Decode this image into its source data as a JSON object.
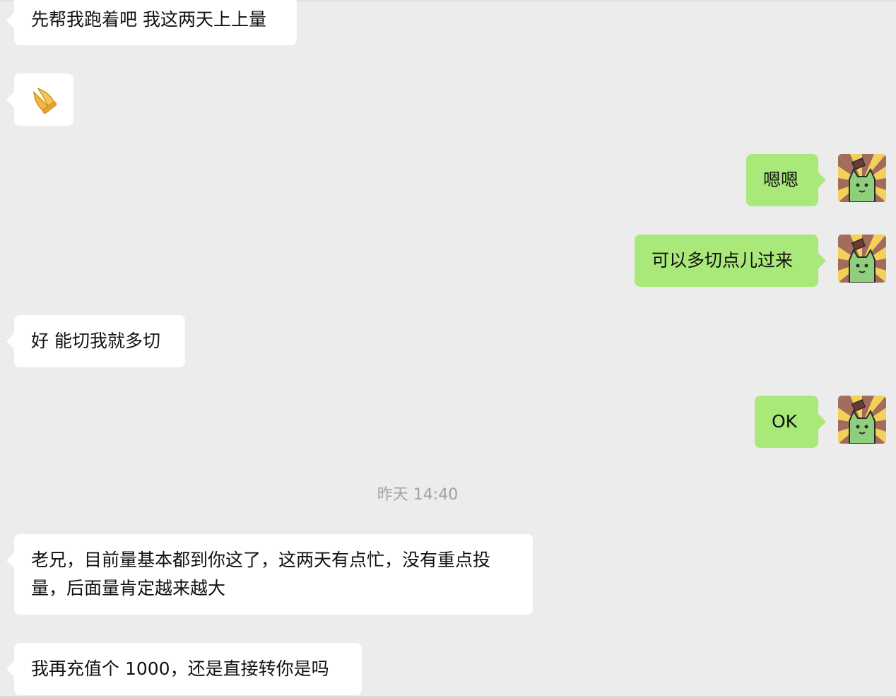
{
  "chat": {
    "messages": [
      {
        "side": "in",
        "text": "先帮我跑着吧 我这两天上上量"
      },
      {
        "side": "in",
        "emoji": "pray-hands-icon"
      },
      {
        "side": "out",
        "text": "嗯嗯"
      },
      {
        "side": "out",
        "text": "可以多切点儿过来"
      },
      {
        "side": "in",
        "text": "好 能切我就多切"
      },
      {
        "side": "out",
        "text": "OK"
      },
      {
        "side": "in",
        "text": "老兄，目前量基本都到你这了，这两天有点忙，没有重点投量，后面量肯定越来越大"
      },
      {
        "side": "in",
        "text": "我再充值个 1000，还是直接转你是吗"
      }
    ],
    "timestamp": "昨天 14:40"
  },
  "colors": {
    "background": "#ececec",
    "incoming_bubble": "#ffffff",
    "outgoing_bubble": "#a9e97a",
    "timestamp_text": "#a2a2a2"
  }
}
